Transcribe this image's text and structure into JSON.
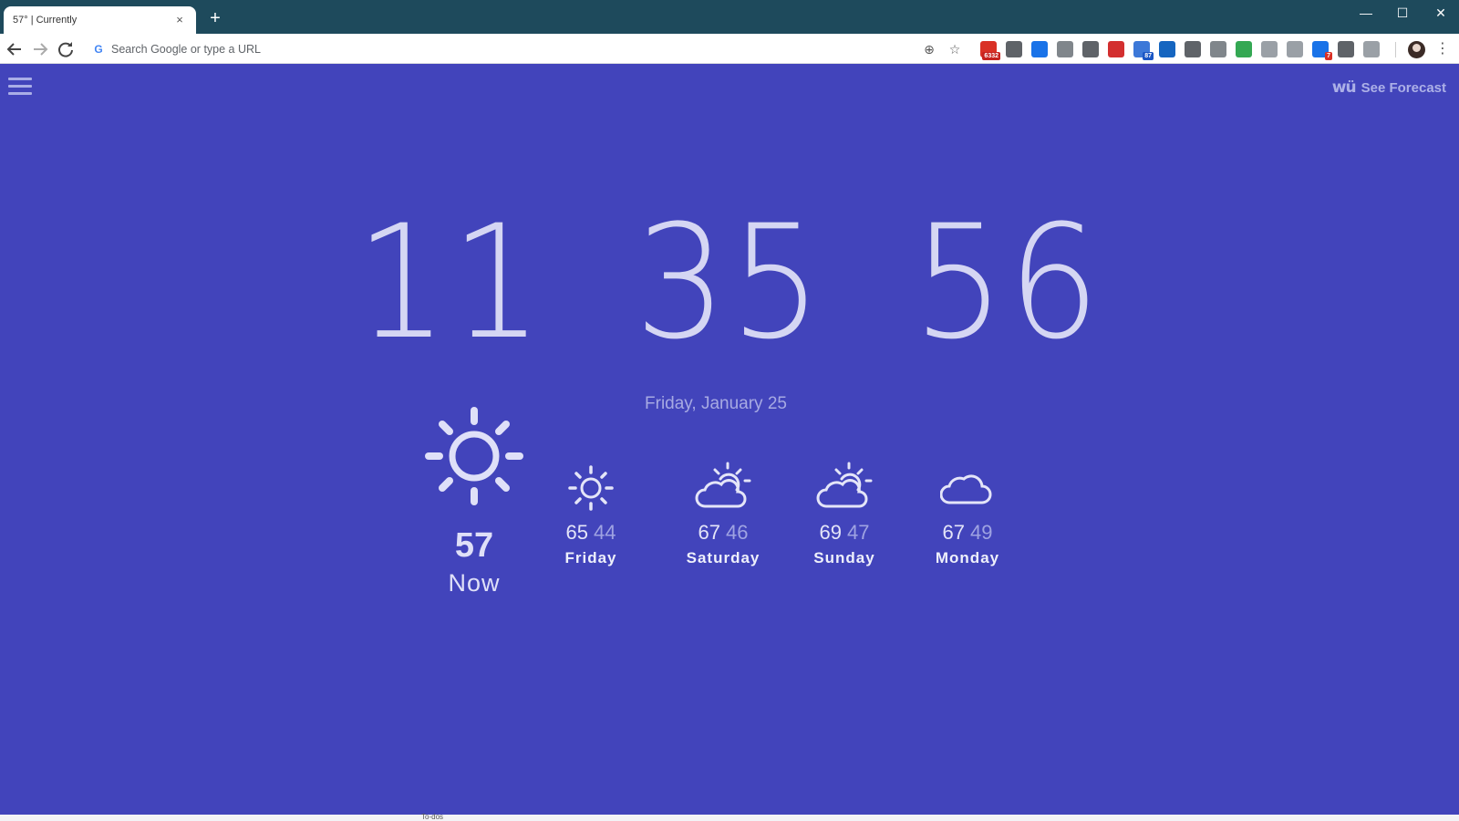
{
  "browser": {
    "tab_title": "57° | Currently",
    "tab_close": "×",
    "new_tab": "+",
    "window_controls": [
      "—",
      "☐",
      "✕"
    ],
    "omnibox_placeholder": "Search Google or type a URL",
    "extensions": [
      {
        "name": "gmail-checker",
        "color": "#d93025",
        "badge": "6332",
        "badge_color": "#c5221f"
      },
      {
        "name": "extension-2",
        "color": "#5f6368",
        "badge": "",
        "badge_color": ""
      },
      {
        "name": "extension-3",
        "color": "#1a73e8",
        "badge": "",
        "badge_color": ""
      },
      {
        "name": "download-icon",
        "color": "#80868b",
        "badge": "",
        "badge_color": ""
      },
      {
        "name": "shield-icon",
        "color": "#5f6368",
        "badge": "",
        "badge_color": ""
      },
      {
        "name": "lastpass-icon",
        "color": "#d32f2f",
        "badge": "",
        "badge_color": ""
      },
      {
        "name": "calendar-icon",
        "color": "#3c78d8",
        "badge": "87",
        "badge_color": "#1a56c4"
      },
      {
        "name": "y-icon",
        "color": "#1565c0",
        "badge": "",
        "badge_color": ""
      },
      {
        "name": "lightbulb-icon",
        "color": "#5f6368",
        "badge": "",
        "badge_color": ""
      },
      {
        "name": "camera-icon",
        "color": "#80868b",
        "badge": "",
        "badge_color": ""
      },
      {
        "name": "check-icon",
        "color": "#34a853",
        "badge": "",
        "badge_color": ""
      },
      {
        "name": "tree-icon",
        "color": "#9aa0a6",
        "badge": "",
        "badge_color": ""
      },
      {
        "name": "chat-icon",
        "color": "#9aa0a6",
        "badge": "",
        "badge_color": ""
      },
      {
        "name": "todo-icon",
        "color": "#1a73e8",
        "badge": "7",
        "badge_color": "#d93025"
      },
      {
        "name": "bird-icon",
        "color": "#5f6368",
        "badge": "",
        "badge_color": ""
      },
      {
        "name": "circle-icon",
        "color": "#9aa0a6",
        "badge": "",
        "badge_color": ""
      }
    ]
  },
  "page": {
    "bg_color": "#4244bb",
    "see_forecast": "See Forecast",
    "wu_logo": "wü",
    "clock": {
      "hours": "11",
      "minutes": "35",
      "seconds": "56"
    },
    "date": "Friday, January 25",
    "now": {
      "temp": "57",
      "label": "Now",
      "icon": "sun-icon"
    },
    "forecast": [
      {
        "day": "Friday",
        "high": "65",
        "low": "44",
        "icon": "sun-icon"
      },
      {
        "day": "Saturday",
        "high": "67",
        "low": "46",
        "icon": "partly-cloudy-icon"
      },
      {
        "day": "Sunday",
        "high": "69",
        "low": "47",
        "icon": "partly-cloudy-icon"
      },
      {
        "day": "Monday",
        "high": "67",
        "low": "49",
        "icon": "cloud-icon"
      }
    ],
    "bottom_peek_text": "To-dos"
  }
}
